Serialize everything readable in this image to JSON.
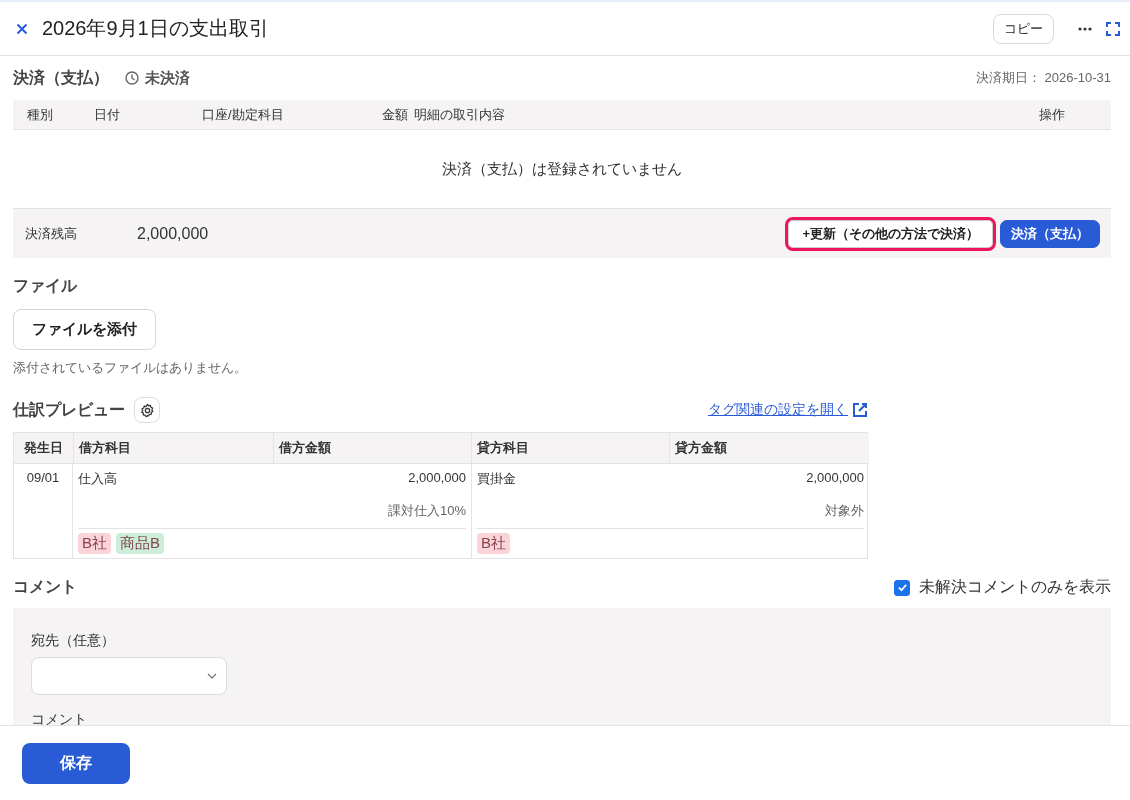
{
  "header": {
    "title": "2026年9月1日の支出取引",
    "copy_button": "コピー"
  },
  "settlement": {
    "title": "決済（支払）",
    "status": "未決済",
    "due": "決済期日： 2026-10-31",
    "columns": [
      "種別",
      "日付",
      "口座/勘定科目",
      "金額",
      "明細の取引内容",
      "操作"
    ],
    "empty_message": "決済（支払）は登録されていません",
    "balance_label": "決済残高",
    "balance": "2,000,000",
    "buttons": [
      {
        "label": "+更新（その他の方法で決済）",
        "kind": "secondary",
        "highlighted": true
      },
      {
        "label": "決済（支払）",
        "kind": "primary",
        "highlighted": false
      }
    ]
  },
  "files": {
    "title": "ファイル",
    "attach_button": "ファイルを添付",
    "empty_message": "添付されているファイルはありません。"
  },
  "journal": {
    "title": "仕訳プレビュー",
    "link": "タグ関連の設定を開く",
    "columns": [
      "発生日",
      "借方科目",
      "借方金額",
      "貸方科目",
      "貸方金額"
    ],
    "rows": [
      {
        "date": "09/01",
        "debit": {
          "account": "仕入高",
          "amount": "2,000,000",
          "tax": "課対仕入10%",
          "tags": [
            {
              "label": "B社",
              "color": "#fad4d8"
            },
            {
              "label": "商品B",
              "color": "#cdeedb"
            }
          ]
        },
        "credit": {
          "account": "買掛金",
          "amount": "2,000,000",
          "tax": "対象外",
          "tags": [
            {
              "label": "B社",
              "color": "#fad4d8"
            }
          ]
        }
      }
    ]
  },
  "comments": {
    "title": "コメント",
    "unresolved_only": {
      "label": "未解決コメントのみを表示",
      "checked": true
    },
    "recipient_label": "宛先（任意）",
    "comment_label": "コメント"
  },
  "footer": {
    "save_button": "保存"
  }
}
